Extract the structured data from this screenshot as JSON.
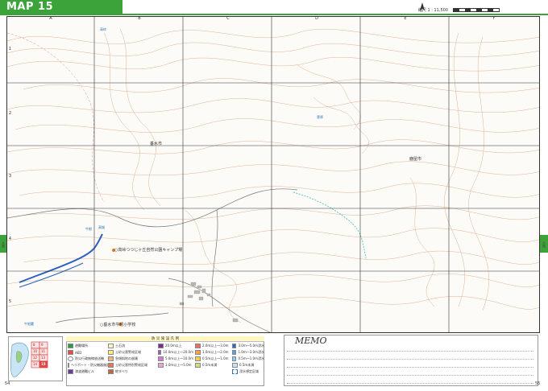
{
  "header": {
    "title": "MAP 15",
    "scale_label": "縮尺 1 : 11,500"
  },
  "grid": {
    "columns": [
      "A",
      "B",
      "C",
      "D",
      "E",
      "F"
    ],
    "rows": [
      "1",
      "2",
      "3",
      "4",
      "5"
    ]
  },
  "map_labels": {
    "city_west": "垂水市",
    "city_east": "鹿屋市",
    "facility": "○高峠つつじヶ丘自然公園キャンプ場",
    "facility2": "○垂水市牛根小学校",
    "river_north": "高峠",
    "river_mid": "菅原",
    "place_left": "高城",
    "place_left2": "牛根",
    "bottom_left": "牛根麓"
  },
  "side_tabs": {
    "left": "大隅",
    "right": "大隅"
  },
  "legend": {
    "header": [
      "防",
      "災",
      "施",
      "設",
      "凡",
      "例"
    ],
    "items_col1": [
      "避難場所",
      "AED",
      "防災行政無線放送機",
      "ヘリポート・防災機器施設",
      "津波避難ビル"
    ],
    "items_col2": [
      "土石流",
      "土砂災害警戒区域",
      "急傾斜地の崩壊",
      "土砂災害特別警戒区域",
      "地すべり"
    ],
    "items_col3": [
      "20.0m以上",
      "10.0m以上～20.0m",
      "5.0m以上～10.0m",
      "3.0m以上～5.0m"
    ],
    "items_col4": [
      "2.0m以上～3.0m",
      "1.0m以上～2.0m",
      "0.5m以上～1.0m",
      "0.5m未満"
    ],
    "items_col5": [
      "3.0m～5.0m浸水",
      "1.0m～3.0m浸水",
      "0.5m～1.0m浸水",
      "0.5m未満",
      "浸水想定区域"
    ]
  },
  "inset": {
    "numbers": [
      "8",
      "9",
      "10",
      "11",
      "12",
      "13",
      "14",
      "15"
    ],
    "highlight": "15"
  },
  "memo": {
    "title": "MEMO"
  },
  "pages": {
    "left": "54",
    "right": "55"
  },
  "colors": {
    "accent": "#3ca33a",
    "contour": "#d9a57f",
    "water": "#2a5fc1",
    "grid": "#333333"
  }
}
